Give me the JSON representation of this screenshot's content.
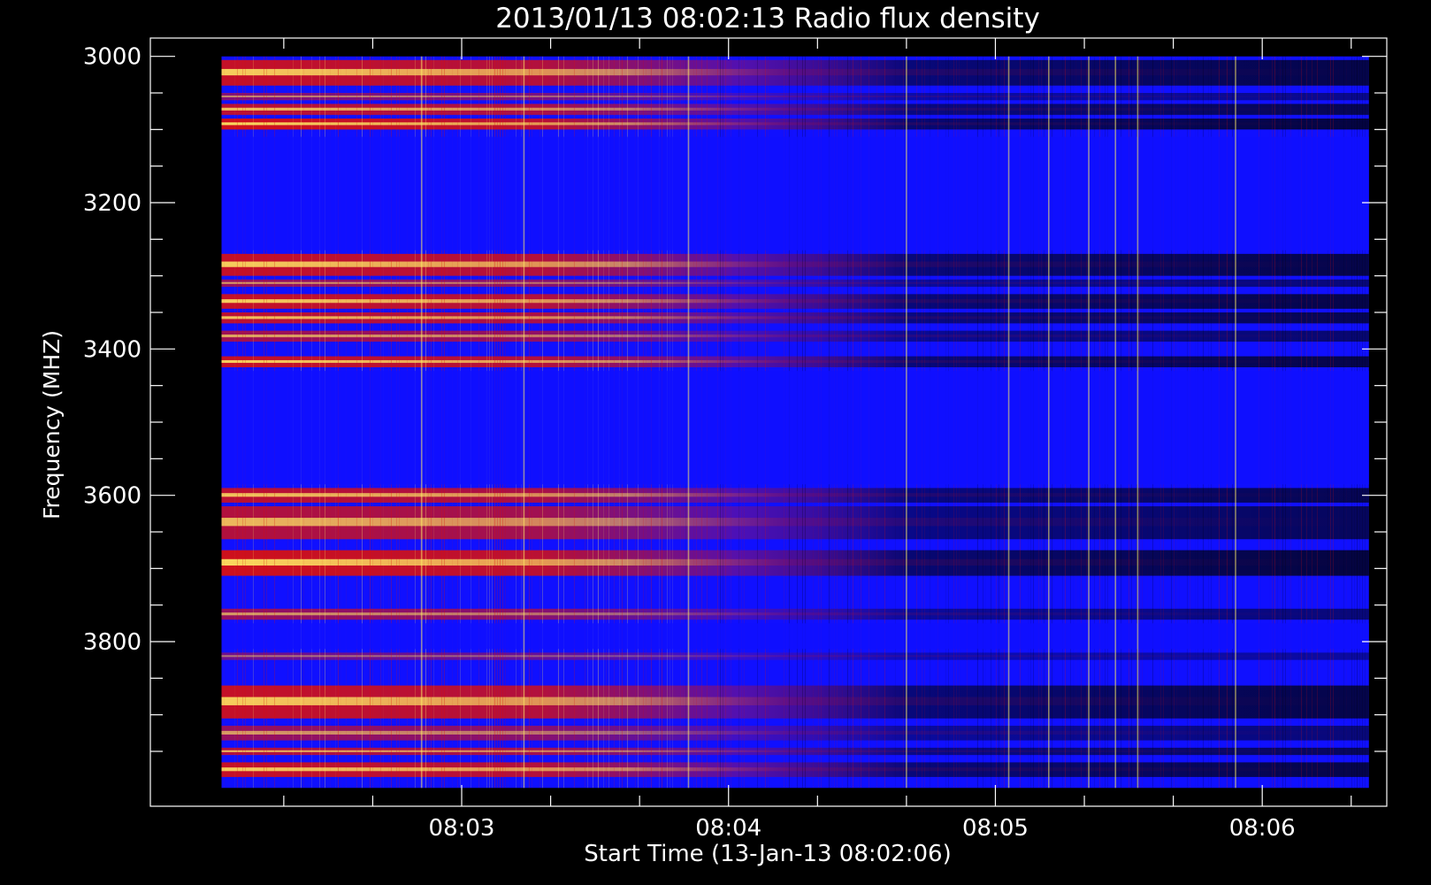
{
  "chart_data": {
    "type": "heatmap",
    "title": "2013/01/13 08:02:13 Radio flux density",
    "xlabel": "Start Time (13-Jan-13 08:02:06)",
    "ylabel": "Frequency (MHZ)",
    "x_range": [
      "08:02:06",
      "08:06:24"
    ],
    "y_range_mhz": [
      3000,
      4000
    ],
    "axis_limits": {
      "x": [
        "08:01:50",
        "08:06:28"
      ],
      "y": [
        2975,
        4025
      ]
    },
    "x_major_ticks": [
      "08:03",
      "08:04",
      "08:05",
      "08:06"
    ],
    "x_minor_tick_step_s": 20,
    "y_major_ticks": [
      3000,
      3200,
      3400,
      3600,
      3800
    ],
    "y_minor_tick_step_mhz": 50,
    "colormap": {
      "background": "#1010ff",
      "low": "#000000",
      "mid": "#d81010",
      "high": "#ffee66"
    },
    "emission_bands_mhz": [
      {
        "f0": 3005,
        "f1": 3040,
        "intensity": 0.95
      },
      {
        "f0": 3050,
        "f1": 3060,
        "intensity": 0.6
      },
      {
        "f0": 3065,
        "f1": 3080,
        "intensity": 0.9
      },
      {
        "f0": 3085,
        "f1": 3100,
        "intensity": 1.0
      },
      {
        "f0": 3270,
        "f1": 3300,
        "intensity": 0.95
      },
      {
        "f0": 3305,
        "f1": 3315,
        "intensity": 0.7
      },
      {
        "f0": 3325,
        "f1": 3345,
        "intensity": 0.95
      },
      {
        "f0": 3350,
        "f1": 3365,
        "intensity": 0.9
      },
      {
        "f0": 3375,
        "f1": 3390,
        "intensity": 0.75
      },
      {
        "f0": 3410,
        "f1": 3425,
        "intensity": 0.95
      },
      {
        "f0": 3590,
        "f1": 3610,
        "intensity": 0.9
      },
      {
        "f0": 3615,
        "f1": 3660,
        "intensity": 0.85
      },
      {
        "f0": 3675,
        "f1": 3710,
        "intensity": 1.0
      },
      {
        "f0": 3755,
        "f1": 3770,
        "intensity": 0.7
      },
      {
        "f0": 3815,
        "f1": 3825,
        "intensity": 0.5
      },
      {
        "f0": 3860,
        "f1": 3905,
        "intensity": 0.95
      },
      {
        "f0": 3915,
        "f1": 3935,
        "intensity": 0.7
      },
      {
        "f0": 3945,
        "f1": 3955,
        "intensity": 0.85
      },
      {
        "f0": 3965,
        "f1": 3985,
        "intensity": 0.95
      }
    ],
    "vertical_spikes_time": [
      "08:02:51",
      "08:03:14",
      "08:03:51",
      "08:04:40",
      "08:05:03",
      "08:05:12",
      "08:05:21",
      "08:05:27",
      "08:05:32",
      "08:05:54"
    ]
  }
}
